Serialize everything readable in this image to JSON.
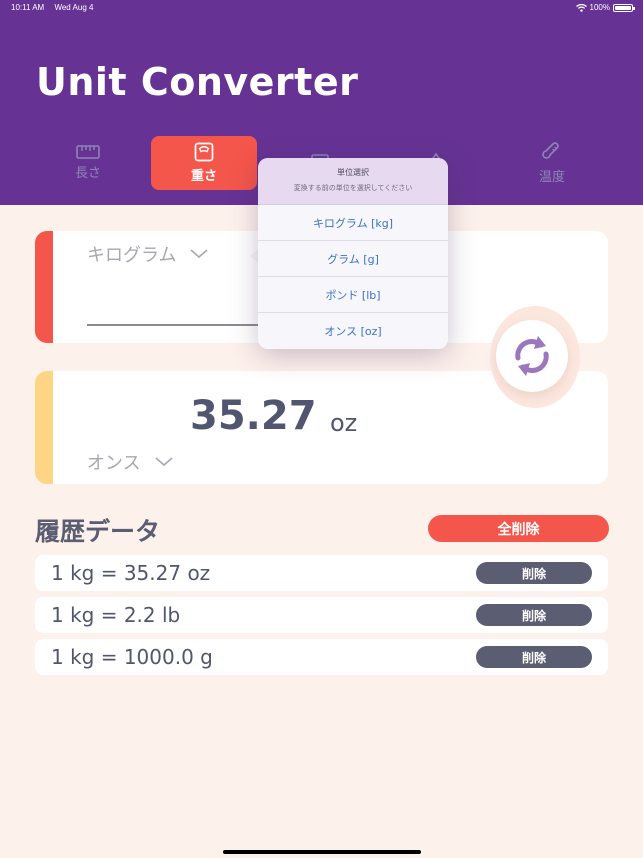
{
  "status_bar": {
    "time": "10:11 AM",
    "date": "Wed Aug 4",
    "battery": "100%"
  },
  "app_title": "Unit Converter",
  "tabs": [
    {
      "label": "長さ",
      "icon": "ruler-icon",
      "active": false
    },
    {
      "label": "重さ",
      "icon": "scale-icon",
      "active": true
    },
    {
      "label": "",
      "icon": "area-icon",
      "active": false
    },
    {
      "label": "",
      "icon": "drop-icon",
      "active": false
    },
    {
      "label": "温度",
      "icon": "thermometer-icon",
      "active": false
    }
  ],
  "converter": {
    "from_unit": "キログラム",
    "to_value": "35.27",
    "to_unit_symbol": "oz",
    "to_unit": "オンス"
  },
  "popover": {
    "title": "単位選択",
    "subtitle": "変換する前の単位を選択してください",
    "options": [
      "キログラム [kg]",
      "グラム [g]",
      "ポンド [lb]",
      "オンス [oz]"
    ]
  },
  "history": {
    "title": "履歴データ",
    "clear_all_label": "全削除",
    "delete_label": "削除",
    "items": [
      "1 kg = 35.27 oz",
      "1 kg = 2.2 lb",
      "1 kg = 1000.0 g"
    ]
  },
  "colors": {
    "header": "#663394",
    "accent": "#f5564b",
    "from_stripe": "#f5564b",
    "to_stripe": "#fdd585",
    "background": "#fdf1ec"
  }
}
